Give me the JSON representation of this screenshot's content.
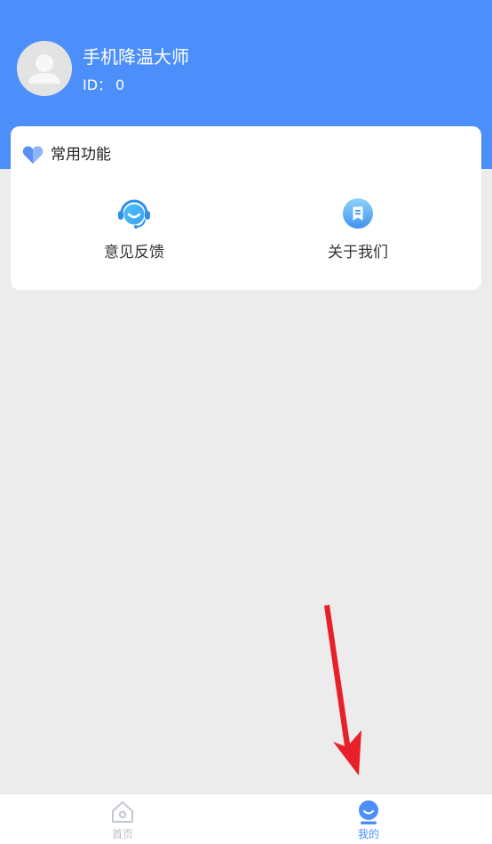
{
  "profile": {
    "name": "手机降温大师",
    "id_label": "ID：",
    "id_value": "0"
  },
  "common_functions": {
    "title": "常用功能",
    "items": [
      {
        "label": "意见反馈",
        "icon": "customer-service-icon"
      },
      {
        "label": "关于我们",
        "icon": "document-icon"
      }
    ]
  },
  "tabbar": {
    "items": [
      {
        "label": "首页",
        "icon": "home-icon",
        "active": false
      },
      {
        "label": "我的",
        "icon": "user-icon",
        "active": true
      }
    ]
  },
  "colors": {
    "accent": "#4c8ffb",
    "background": "#ececec",
    "inactive_tab": "#b8bcc6",
    "annotation_arrow": "#e8202a"
  }
}
